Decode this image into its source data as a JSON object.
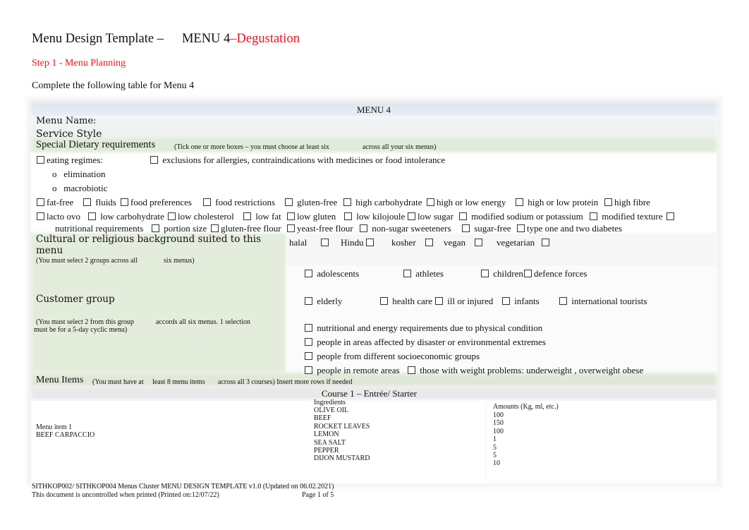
{
  "header": {
    "title_prefix": "Menu Design Template –",
    "title_menu": "MENU 4",
    "title_suffix": "–Degustation",
    "step": "Step 1 - Menu Planning",
    "intro": "Complete the following table for Menu 4"
  },
  "table": {
    "heading": "MENU 4",
    "menu_name_label": "Menu Name:",
    "service_style_label": "Service Style",
    "dietary": {
      "label": "Special Dietary requirements",
      "note_a": "(Tick one or more boxes – you must choose at least six",
      "note_b": "across all your six menus)",
      "eating_regimes": "eating regimes:",
      "exclusions": "exclusions for allergies, contraindications with medicines or food intolerance",
      "sub_items": [
        "elimination",
        "macrobiotic"
      ],
      "row1": [
        "fat-free",
        "fluids",
        "food preferences",
        "food restrictions",
        "gluten-free",
        "high carbohydrate",
        "high or low energy",
        "high or low protein",
        "high fibre"
      ],
      "row2": [
        "lacto ovo",
        "low carbohydrate",
        "low cholesterol",
        "low fat",
        "low gluten",
        "low kilojoule",
        "low sugar",
        "modified sodium or potassium",
        "modified texture"
      ],
      "row3_lead": "nutritional requirements",
      "row3": [
        "portion size",
        "gluten-free flour",
        "yeast-free flour",
        "non-sugar sweeteners",
        "sugar-free",
        "type one and two diabetes"
      ]
    },
    "cultural": {
      "label_line1": "Cultural or religious background suited to this",
      "label_line2": "menu",
      "note_a": "(You must select 2 groups across all",
      "note_b": "six menus)",
      "options": [
        "halal",
        "Hindu",
        "kosher",
        "vegan",
        "vegetarian"
      ]
    },
    "customer": {
      "label": "Customer group",
      "note_a": "(You must select 2 from this group",
      "note_b": "accords all six menus. 1 selection",
      "note_c": "must be for a 5-day cyclic menu)",
      "row1": [
        "adolescents",
        "athletes",
        "children",
        "defence forces"
      ],
      "row2": [
        "elderly",
        "health care",
        "ill or injured",
        "infants",
        "international tourists"
      ],
      "lines": [
        "nutritional and energy requirements due to physical condition",
        "people in areas affected by disaster or environmental extremes",
        "people from different socioeconomic groups"
      ],
      "last_a": "people in remote areas",
      "last_b": "those with weight problems: underweight , overweight obese"
    },
    "menu_items": {
      "label": "Menu Items",
      "note_a": "(You must have at",
      "note_b": "least 8 menu items",
      "note_c": "across all 3 courses) Insert more rows if needed",
      "course": "Course 1 – Entrée/ Starter",
      "item_label": "Menu item 1",
      "item_name": "BEEF CARPACCIO",
      "ingredients_label": "Ingredients",
      "ingredients": [
        "OLIVE OIL",
        "BEEF",
        "ROCKET LEAVES",
        "LEMON",
        "SEA SALT",
        "PEPPER",
        "DIJON MUSTARD"
      ],
      "amounts_label": "Amounts (Kg, ml, etc.)",
      "amounts": [
        "100",
        "150",
        "100",
        "1",
        "5",
        "5",
        "10"
      ]
    }
  },
  "footer": {
    "line1": "SITHKOP002/ SITHKOP004 Menus Cluster MENU DESIGN TEMPLATE v1.0 (Updated on 06.02.2021)",
    "line2": "This document is uncontrolled when printed (Printed on:12/07/22)",
    "page": "Page 1 of 5"
  }
}
